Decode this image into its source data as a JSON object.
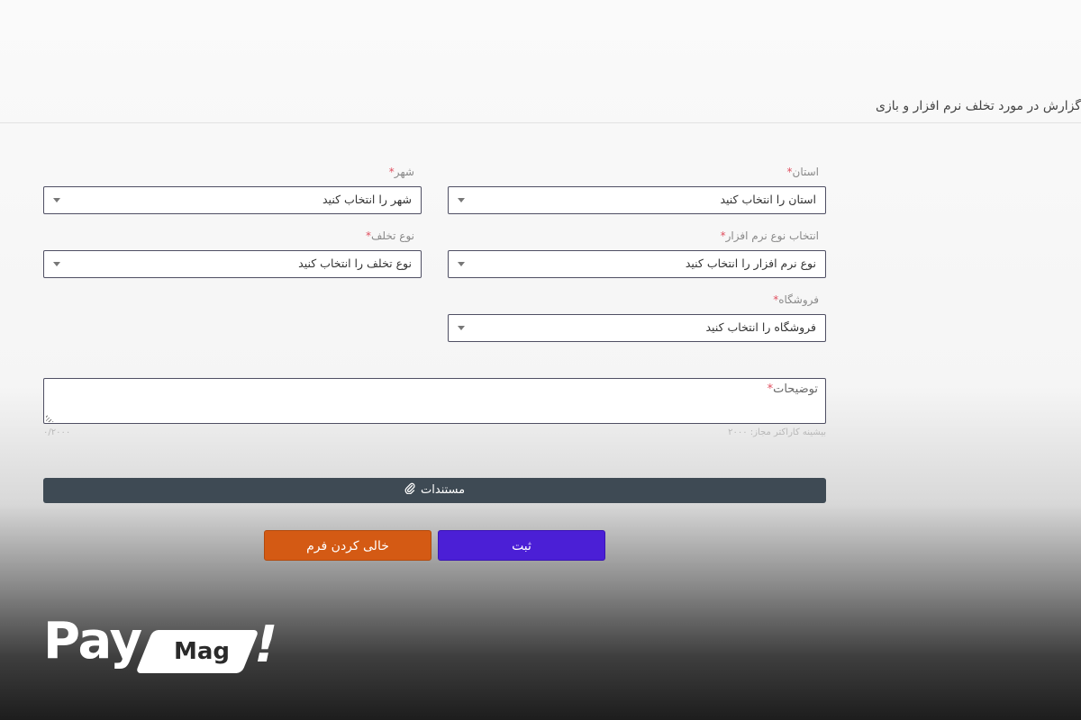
{
  "page": {
    "title": "گزارش در مورد تخلف نرم افزار و بازی"
  },
  "form": {
    "province": {
      "label": "استان",
      "placeholder": "استان را انتخاب کنید"
    },
    "city": {
      "label": "شهر",
      "placeholder": "شهر را انتخاب کنید"
    },
    "software_type": {
      "label": "انتخاب نوع نرم افزار",
      "placeholder": "نوع نرم افزار را انتخاب کنید"
    },
    "violation_type": {
      "label": "نوع تخلف",
      "placeholder": "نوع تخلف را انتخاب کنید"
    },
    "store": {
      "label": "فروشگاه",
      "placeholder": "فروشگاه را انتخاب کنید"
    },
    "description": {
      "label": "توضیحات",
      "max_hint": "بیشینه کاراکتر مجاز: ۲۰۰۰",
      "counter": "۰/۲۰۰۰"
    },
    "required_mark": "*",
    "documents_label": "مستندات",
    "submit_label": "ثبت",
    "clear_label": "خالی کردن فرم"
  },
  "brand": {
    "logo_pay": "Pay",
    "logo_mag": "Mag",
    "logo_bang": "!"
  },
  "colors": {
    "submit": "#4b1fd6",
    "clear": "#d45a14",
    "documents_bar": "#3e4a54",
    "required": "#e05060"
  },
  "icons": {
    "documents": "paperclip-icon",
    "select_caret": "caret-down-icon"
  }
}
